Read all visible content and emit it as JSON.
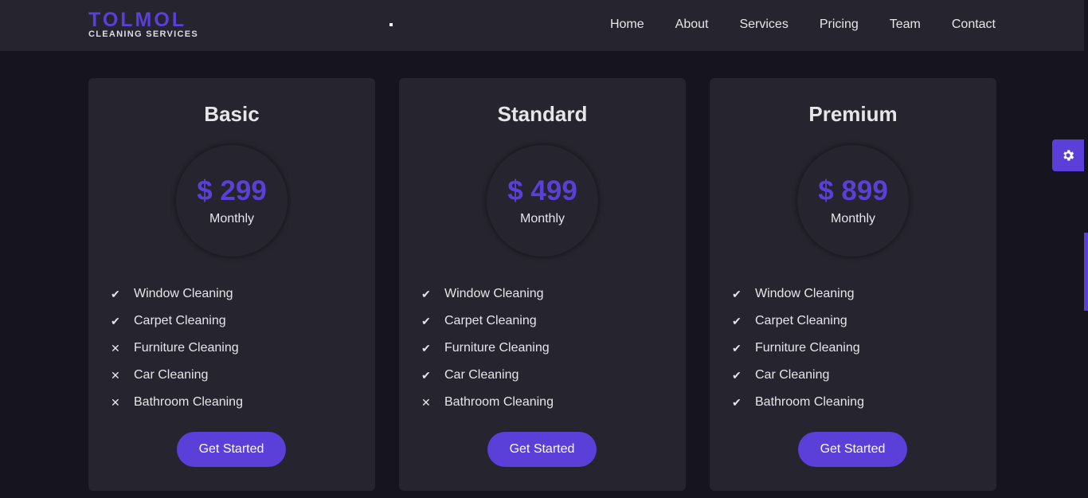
{
  "brand": {
    "name": "TOLMOL",
    "tagline": "CLEANING SERVICES"
  },
  "nav": {
    "items": [
      "Home",
      "About",
      "Services",
      "Pricing",
      "Team",
      "Contact"
    ]
  },
  "colors": {
    "accent": "#5b3fd9",
    "background": "#16141f",
    "card": "#26242e",
    "navbar": "#26242e"
  },
  "settings": {
    "icon": "gear-icon"
  },
  "plans": [
    {
      "name": "Basic",
      "price": "$ 299",
      "period": "Monthly",
      "features": [
        {
          "label": "Window Cleaning",
          "included": true
        },
        {
          "label": "Carpet Cleaning",
          "included": true
        },
        {
          "label": "Furniture Cleaning",
          "included": false
        },
        {
          "label": "Car Cleaning",
          "included": false
        },
        {
          "label": "Bathroom Cleaning",
          "included": false
        }
      ],
      "cta": "Get Started"
    },
    {
      "name": "Standard",
      "price": "$ 499",
      "period": "Monthly",
      "features": [
        {
          "label": "Window Cleaning",
          "included": true
        },
        {
          "label": "Carpet Cleaning",
          "included": true
        },
        {
          "label": "Furniture Cleaning",
          "included": true
        },
        {
          "label": "Car Cleaning",
          "included": true
        },
        {
          "label": "Bathroom Cleaning",
          "included": false
        }
      ],
      "cta": "Get Started"
    },
    {
      "name": "Premium",
      "price": "$ 899",
      "period": "Monthly",
      "features": [
        {
          "label": "Window Cleaning",
          "included": true
        },
        {
          "label": "Carpet Cleaning",
          "included": true
        },
        {
          "label": "Furniture Cleaning",
          "included": true
        },
        {
          "label": "Car Cleaning",
          "included": true
        },
        {
          "label": "Bathroom Cleaning",
          "included": true
        }
      ],
      "cta": "Get Started"
    }
  ]
}
